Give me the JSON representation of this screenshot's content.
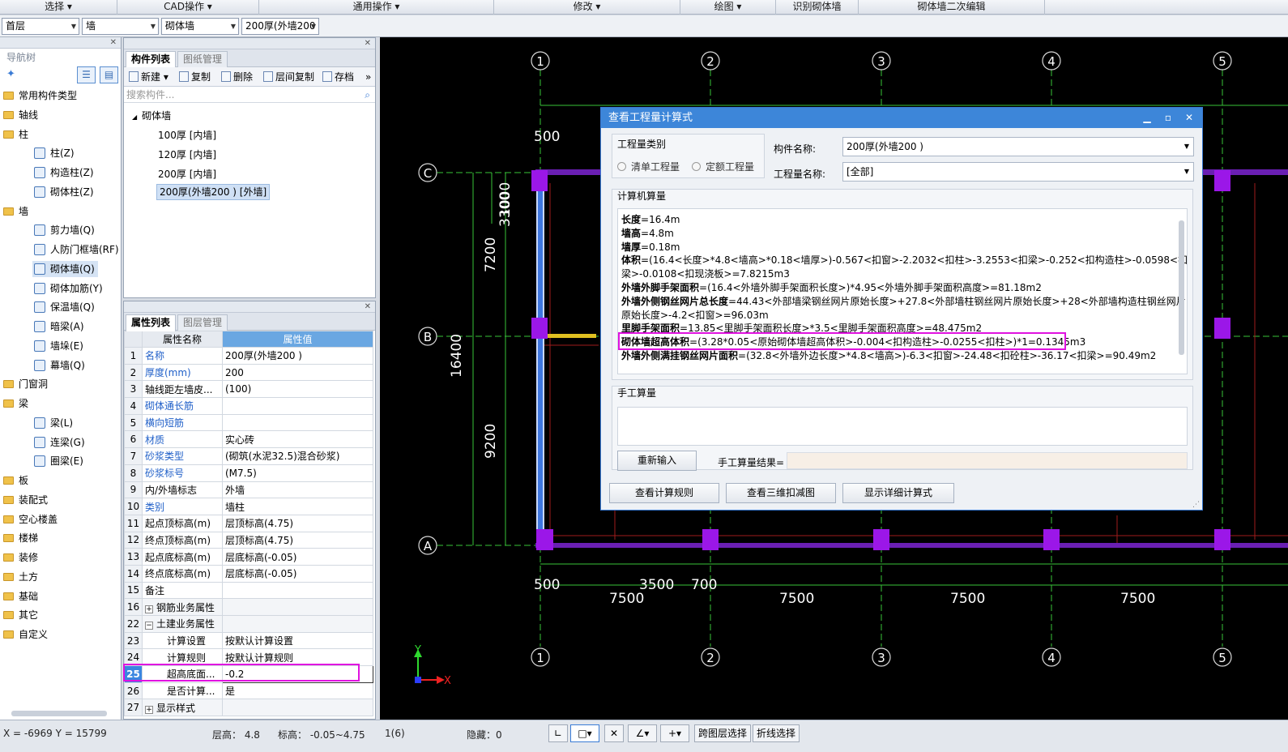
{
  "menubar": {
    "items": [
      "选择 ▾",
      "CAD操作 ▾",
      "通用操作 ▾",
      "修改 ▾",
      "绘图 ▾",
      "识别砌体墙",
      "砌体墙二次编辑"
    ]
  },
  "selectors": {
    "floor": "首层",
    "category": "墙",
    "type": "砌体墙",
    "component": "200厚(外墙200"
  },
  "nav": {
    "title": "导航树",
    "items": [
      {
        "label": "常用构件类型",
        "kind": "folder"
      },
      {
        "label": "轴线",
        "kind": "folder"
      },
      {
        "label": "柱",
        "kind": "folder"
      },
      {
        "label": "柱(Z)",
        "kind": "leaf"
      },
      {
        "label": "构造柱(Z)",
        "kind": "leaf"
      },
      {
        "label": "砌体柱(Z)",
        "kind": "leaf"
      },
      {
        "label": "墙",
        "kind": "folder"
      },
      {
        "label": "剪力墙(Q)",
        "kind": "leaf"
      },
      {
        "label": "人防门框墙(RF)",
        "kind": "leaf"
      },
      {
        "label": "砌体墙(Q)",
        "kind": "leaf",
        "selected": true
      },
      {
        "label": "砌体加筋(Y)",
        "kind": "leaf"
      },
      {
        "label": "保温墙(Q)",
        "kind": "leaf"
      },
      {
        "label": "暗梁(A)",
        "kind": "leaf"
      },
      {
        "label": "墙垛(E)",
        "kind": "leaf"
      },
      {
        "label": "幕墙(Q)",
        "kind": "leaf"
      },
      {
        "label": "门窗洞",
        "kind": "folder"
      },
      {
        "label": "梁",
        "kind": "folder"
      },
      {
        "label": "梁(L)",
        "kind": "leaf"
      },
      {
        "label": "连梁(G)",
        "kind": "leaf"
      },
      {
        "label": "圈梁(E)",
        "kind": "leaf"
      },
      {
        "label": "板",
        "kind": "folder"
      },
      {
        "label": "装配式",
        "kind": "folder"
      },
      {
        "label": "空心楼盖",
        "kind": "folder"
      },
      {
        "label": "楼梯",
        "kind": "folder"
      },
      {
        "label": "装修",
        "kind": "folder"
      },
      {
        "label": "土方",
        "kind": "folder"
      },
      {
        "label": "基础",
        "kind": "folder"
      },
      {
        "label": "其它",
        "kind": "folder"
      },
      {
        "label": "自定义",
        "kind": "folder"
      }
    ]
  },
  "complist": {
    "tabs": [
      "构件列表",
      "图纸管理"
    ],
    "buttons": [
      "新建 ▾",
      "复制",
      "删除",
      "层间复制",
      "存档"
    ],
    "search_placeholder": "搜索构件...",
    "root": "砌体墙",
    "items": [
      "100厚 [内墙]",
      "120厚 [内墙]",
      "200厚 [内墙]",
      "200厚(外墙200 ) [外墙]"
    ]
  },
  "props": {
    "tabs": [
      "属性列表",
      "图层管理"
    ],
    "col_name": "属性名称",
    "col_value": "属性值",
    "rows": [
      {
        "n": "1",
        "name": "名称",
        "value": "200厚(外墙200 )",
        "blue": true
      },
      {
        "n": "2",
        "name": "厚度(mm)",
        "value": "200",
        "blue": true
      },
      {
        "n": "3",
        "name": "轴线距左墙皮...",
        "value": "(100)"
      },
      {
        "n": "4",
        "name": "砌体通长筋",
        "value": "",
        "blue": true
      },
      {
        "n": "5",
        "name": "横向短筋",
        "value": "",
        "blue": true
      },
      {
        "n": "6",
        "name": "材质",
        "value": "实心砖",
        "blue": true
      },
      {
        "n": "7",
        "name": "砂浆类型",
        "value": "(砌筑(水泥32.5)混合砂浆)",
        "blue": true
      },
      {
        "n": "8",
        "name": "砂浆标号",
        "value": "(M7.5)",
        "blue": true
      },
      {
        "n": "9",
        "name": "内/外墙标志",
        "value": "外墙"
      },
      {
        "n": "10",
        "name": "类别",
        "value": "墙柱",
        "blue": true
      },
      {
        "n": "11",
        "name": "起点顶标高(m)",
        "value": "层顶标高(4.75)"
      },
      {
        "n": "12",
        "name": "终点顶标高(m)",
        "value": "层顶标高(4.75)"
      },
      {
        "n": "13",
        "name": "起点底标高(m)",
        "value": "层底标高(-0.05)"
      },
      {
        "n": "14",
        "name": "终点底标高(m)",
        "value": "层底标高(-0.05)"
      },
      {
        "n": "15",
        "name": "备注",
        "value": ""
      },
      {
        "n": "16",
        "name": "钢筋业务属性",
        "value": "",
        "group": "+"
      },
      {
        "n": "22",
        "name": "土建业务属性",
        "value": "",
        "group": "−"
      },
      {
        "n": "23",
        "name": "计算设置",
        "value": "按默认计算设置",
        "indent": true
      },
      {
        "n": "24",
        "name": "计算规则",
        "value": "按默认计算规则",
        "indent": true
      },
      {
        "n": "25",
        "name": "超高底面...",
        "value": "-0.2",
        "indent": true,
        "highlight": true
      },
      {
        "n": "26",
        "name": "是否计算...",
        "value": "是",
        "indent": true
      },
      {
        "n": "27",
        "name": "显示样式",
        "value": "",
        "group": "+"
      }
    ]
  },
  "canvas": {
    "axis_numbers": [
      "1",
      "2",
      "3",
      "4",
      "5"
    ],
    "axis_letters": [
      "C",
      "B",
      "A"
    ],
    "dims_top": [
      "500"
    ],
    "dims_left": [
      "7200",
      "16400",
      "9200",
      "3300",
      "1000"
    ],
    "dims_bottom_small": [
      "500",
      "3500",
      "700"
    ],
    "dims_bottom": [
      "7500",
      "7500",
      "7500",
      "7500"
    ],
    "ucs_x": "X",
    "ucs_y": "Y"
  },
  "dialog": {
    "title": "查看工程量计算式",
    "qty_type_label": "工程量类别",
    "radio1": "清单工程量",
    "radio2": "定额工程量",
    "comp_name_label": "构件名称:",
    "comp_name_value": "200厚(外墙200 )",
    "qty_name_label": "工程量名称:",
    "qty_name_value": "[全部]",
    "computer_label": "计算机算量",
    "lines": [
      {
        "k": "长度",
        "v": "=16.4m"
      },
      {
        "k": "墙高",
        "v": "=4.8m"
      },
      {
        "k": "墙厚",
        "v": "=0.18m"
      },
      {
        "k": "体积",
        "v": "=(16.4<长度>*4.8<墙高>*0.18<墙厚>)-0.567<扣窗>-2.2032<扣柱>-3.2553<扣梁>-0.252<扣构造柱>-0.0598<扣砼过"
      },
      {
        "k": "",
        "v": "梁>-0.0108<扣现浇板>=7.8215m3"
      },
      {
        "k": "外墙外脚手架面积",
        "v": "=(16.4<外墙外脚手架面积长度>)*4.95<外墙外脚手架面积高度>=81.18m2"
      },
      {
        "k": "外墙外侧钢丝网片总长度",
        "v": "=44.43<外部墙梁钢丝网片原始长度>+27.8<外部墙柱钢丝网片原始长度>+28<外部墙构造柱钢丝网片"
      },
      {
        "k": "",
        "v": "原始长度>-4.2<扣窗>=96.03m"
      },
      {
        "k": "里脚手架面积",
        "v": "=13.85<里脚手架面积长度>*3.5<里脚手架面积高度>=48.475m2"
      },
      {
        "k": "砌体墙超高体积",
        "v": "=(3.28*0.05<原始砌体墙超高体积>-0.004<扣构造柱>-0.0255<扣柱>)*1=0.1345m3"
      },
      {
        "k": "外墙外侧满挂钢丝网片面积",
        "v": "=(32.8<外墙外边长度>*4.8<墙高>)-6.3<扣窗>-24.48<扣砼柱>-36.17<扣梁>=90.49m2"
      }
    ],
    "manual_label": "手工算量",
    "reenter": "重新输入",
    "manual_result_label": "手工算量结果=",
    "btn_rules": "查看计算规则",
    "btn_3d": "查看三维扣减图",
    "btn_detail": "显示详细计算式"
  },
  "status": {
    "coords": "X = -6969 Y = 15799",
    "floor_height": "层高： 4.8",
    "elevation": "标高： -0.05~4.75",
    "count": "1(6)",
    "hidden": "隐藏：0",
    "btn_cross_layer": "跨图层选择",
    "btn_polyline": "折线选择"
  }
}
